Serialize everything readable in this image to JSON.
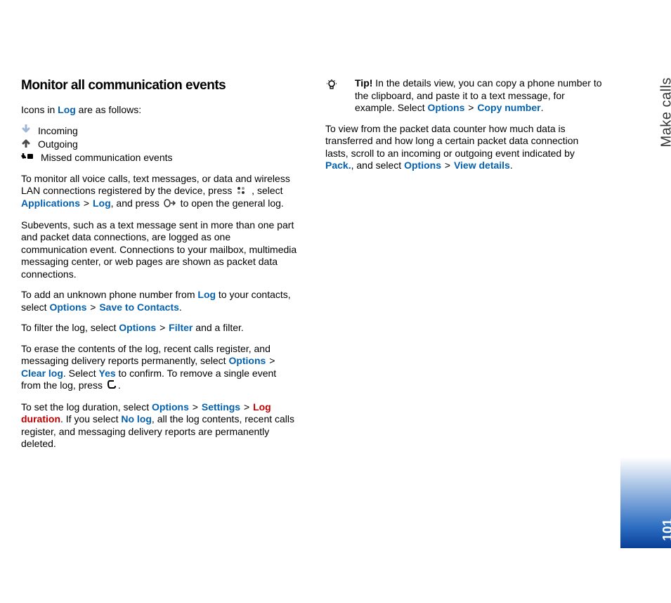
{
  "sidebar": {
    "section": "Make calls",
    "page_number": "101"
  },
  "h": {
    "title": "Monitor all communication events"
  },
  "intro": {
    "a": "Icons in ",
    "b": "Log",
    "c": " are as follows:"
  },
  "icons": {
    "incoming": "Incoming",
    "outgoing": "Outgoing",
    "missed": "Missed communication events"
  },
  "p1": {
    "a": "To monitor all voice calls, text messages, or data and wireless LAN connections registered by the device, press ",
    "b": " , select ",
    "c": "Applications",
    "d": " > ",
    "e": "Log",
    "f": ", and press ",
    "g": " to open the general log."
  },
  "p2": {
    "a": "Subevents, such as a text message sent in more than one part and packet data connections, are logged as one communication event. Connections to your mailbox, multimedia messaging center, or web pages are shown as packet data connections."
  },
  "p3": {
    "a": "To add an unknown phone number from ",
    "b": "Log",
    "c": " to your contacts, select ",
    "d": "Options",
    "e": " > ",
    "f": "Save to Contacts",
    "g": "."
  },
  "p4": {
    "a": "To filter the log, select ",
    "b": "Options",
    "c": " > ",
    "d": "Filter",
    "e": " and a filter."
  },
  "p5": {
    "a": "To erase the contents of the log, recent calls register, and messaging delivery reports permanently, select ",
    "b": "Options",
    "c": " > ",
    "d": "Clear log",
    "e": ". Select ",
    "f": "Yes",
    "g": " to confirm. To remove a single event from the log, press ",
    "h": "."
  },
  "p6": {
    "a": "To set the log duration, select ",
    "b": "Options",
    "c": " > ",
    "d": "Settings",
    "e": " > ",
    "f": "Log duration",
    "g": ". If you select ",
    "h": "No log",
    "i": ", all the log contents, recent calls register, and messaging delivery reports are permanently deleted."
  },
  "tip": {
    "label": "Tip!",
    "a": " In the details view, you can copy a phone number to the clipboard, and paste it to a text message, for example. Select ",
    "b": "Options",
    "c": " > ",
    "d": "Copy number",
    "e": "."
  },
  "p7": {
    "a": "To view from the packet data counter how much data is transferred and how long a certain packet data connection lasts, scroll to an incoming or outgoing event indicated by ",
    "b": "Pack.",
    "c": ", and select ",
    "d": "Options",
    "e": " > ",
    "f": "View details",
    "g": "."
  }
}
